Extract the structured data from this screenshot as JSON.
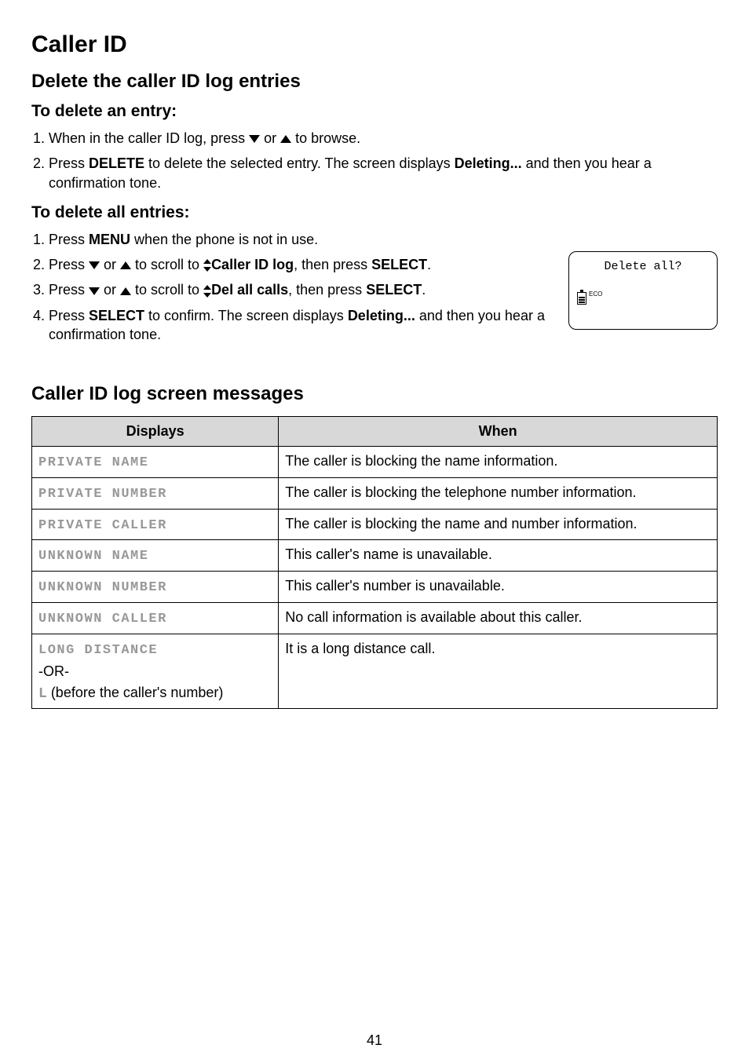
{
  "page": {
    "title": "Caller ID",
    "number": "41"
  },
  "section_a": {
    "heading": "Delete the caller ID log entries",
    "sub1": {
      "heading": "To delete an entry:",
      "steps": {
        "s1_pre": "When in the caller ID log, press ",
        "s1_mid": " or ",
        "s1_post": " to browse.",
        "s2_pre": "Press ",
        "s2_b1": "DELETE",
        "s2_mid": " to delete the selected entry. The screen displays ",
        "s2_b2": "Deleting...",
        "s2_post": " and then you hear a confirmation tone."
      }
    },
    "sub2": {
      "heading": "To delete all entries:",
      "steps": {
        "s1_pre": "Press ",
        "s1_b1": "MENU",
        "s1_post": " when the phone is not in use.",
        "s2_pre": "Press ",
        "s2_mid1": " or ",
        "s2_mid2": " to scroll to ",
        "s2_b1": "Caller ID log",
        "s2_mid3": ", then press ",
        "s2_b2": "SELECT",
        "s2_post": ".",
        "s3_pre": "Press ",
        "s3_mid1": " or ",
        "s3_mid2": " to scroll to ",
        "s3_b1": "Del all calls",
        "s3_mid3": ", then press ",
        "s3_b2": "SELECT",
        "s3_post": ".",
        "s4_pre": "Press ",
        "s4_b1": "SELECT",
        "s4_mid": " to confirm. The screen displays ",
        "s4_b2": "Deleting...",
        "s4_post": " and then you hear a confirmation tone."
      }
    }
  },
  "phone_screen": {
    "line1": "Delete all?",
    "eco": "ECO"
  },
  "section_b": {
    "heading": "Caller ID log screen messages",
    "col1": "Displays",
    "col2": "When",
    "rows": [
      {
        "display": "PRIVATE NAME",
        "when": "The caller is blocking the name information."
      },
      {
        "display": "PRIVATE NUMBER",
        "when": "The caller is blocking the telephone number information."
      },
      {
        "display": "PRIVATE CALLER",
        "when": "The caller is blocking the name and number information."
      },
      {
        "display": "UNKNOWN NAME",
        "when": "This caller's name is unavailable."
      },
      {
        "display": "UNKNOWN NUMBER",
        "when": "This caller's number is unavailable."
      },
      {
        "display": "UNKNOWN CALLER",
        "when": "No call information is available about this caller."
      }
    ],
    "last_row": {
      "display_line1": "LONG DISTANCE",
      "or": "-OR-",
      "Lprefix": "L",
      "Lrest": " (before the caller's number)",
      "when": "It is a long distance call."
    }
  }
}
